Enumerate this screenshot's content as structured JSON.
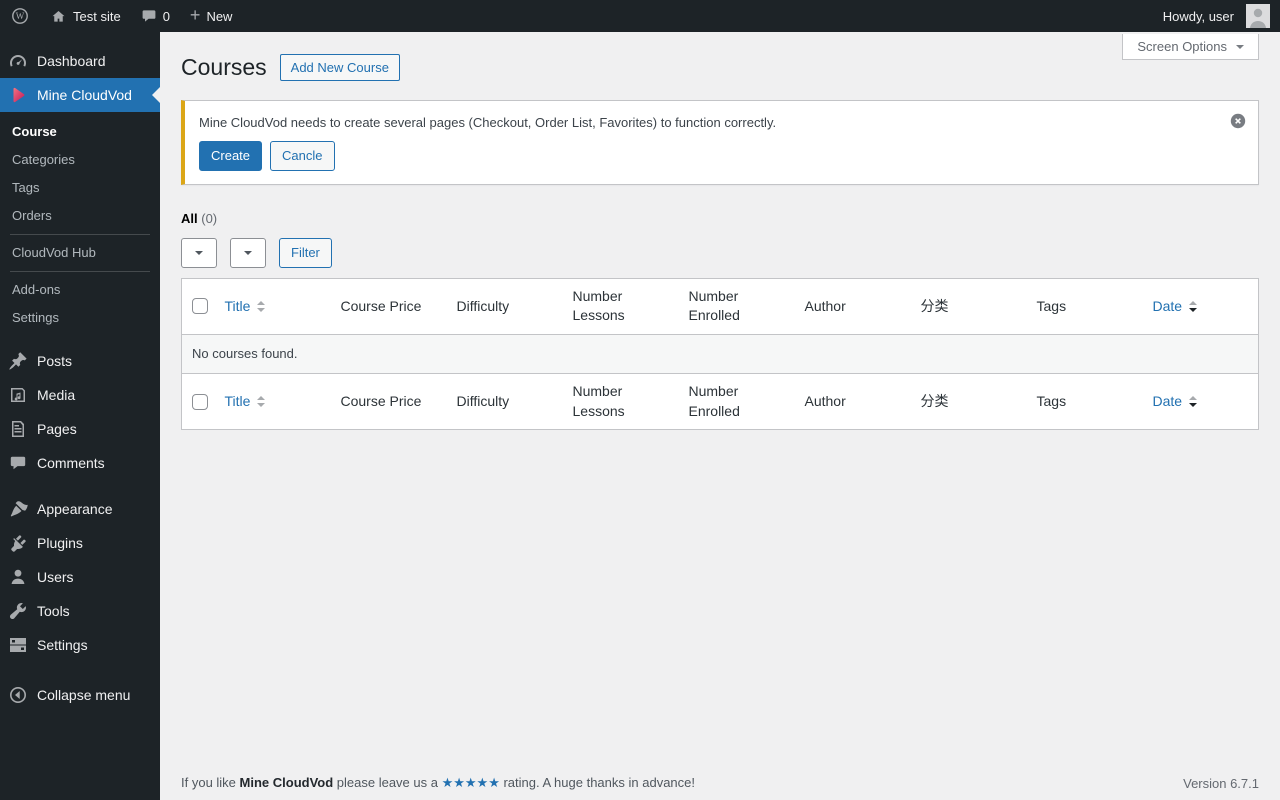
{
  "colors": {
    "admin_bar_bg": "#1d2327",
    "accent": "#2271b1",
    "warning_border": "#dba617",
    "cloudvod_icon": "#e0456b",
    "content_bg": "#f0f0f1"
  },
  "admin_bar": {
    "site_name": "Test site",
    "comments_count": "0",
    "new_label": "New",
    "howdy_text": "Howdy, user"
  },
  "sidebar": {
    "dashboard": "Dashboard",
    "cloudvod": "Mine CloudVod",
    "cloudvod_submenu": {
      "course": "Course",
      "categories": "Categories",
      "tags": "Tags",
      "orders": "Orders",
      "hub": "CloudVod Hub",
      "addons": "Add-ons",
      "settings": "Settings"
    },
    "posts": "Posts",
    "media": "Media",
    "pages": "Pages",
    "comments": "Comments",
    "appearance": "Appearance",
    "plugins": "Plugins",
    "users": "Users",
    "tools": "Tools",
    "settings": "Settings",
    "collapse": "Collapse menu"
  },
  "main": {
    "page_title": "Courses",
    "add_new_label": "Add New Course",
    "screen_options_label": "Screen Options",
    "notice": {
      "message": "Mine CloudVod needs to create several pages (Checkout, Order List, Favorites) to function correctly.",
      "create_label": "Create",
      "cancel_label": "Cancle"
    },
    "views": {
      "all_label": "All",
      "all_count": "(0)"
    },
    "filter_label": "Filter",
    "table": {
      "columns": [
        "Title",
        "Course Price",
        "Difficulty",
        "Number Lessons",
        "Number Enrolled",
        "Author",
        "分类",
        "Tags",
        "Date"
      ],
      "empty_message": "No courses found."
    }
  },
  "footer": {
    "like_prefix": "If you like ",
    "plugin_name": "Mine CloudVod",
    "like_middle": " please leave us a ",
    "stars": "★★★★★",
    "like_suffix": " rating. A huge thanks in advance!",
    "version": "Version 6.7.1"
  }
}
